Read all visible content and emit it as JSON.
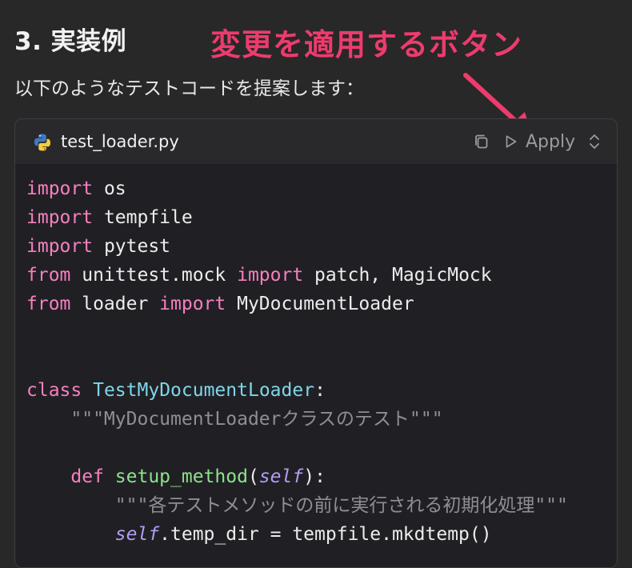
{
  "heading": "3. 実装例",
  "annotation": "変更を適用するボタン",
  "intro": "以下のようなテストコードを提案します：",
  "colors": {
    "annotation": "#ee3b6e",
    "keyword": "#f77fc0",
    "class_name": "#7fd6e9",
    "function_name": "#8fe28a",
    "self": "#b59cf6",
    "docstring": "#8e8e93"
  },
  "code_block": {
    "filename": "test_loader.py",
    "file_icon": "python-icon",
    "copy_icon": "copy-icon",
    "apply_label": "Apply",
    "apply_icon": "play-icon",
    "expand_icon": "chevron-up-down-icon",
    "lines": [
      [
        {
          "t": "import",
          "c": "kw"
        },
        {
          "t": " os",
          "c": "plain"
        }
      ],
      [
        {
          "t": "import",
          "c": "kw"
        },
        {
          "t": " tempfile",
          "c": "plain"
        }
      ],
      [
        {
          "t": "import",
          "c": "kw"
        },
        {
          "t": " pytest",
          "c": "plain"
        }
      ],
      [
        {
          "t": "from",
          "c": "kw"
        },
        {
          "t": " unittest.mock ",
          "c": "plain"
        },
        {
          "t": "import",
          "c": "kw"
        },
        {
          "t": " patch, MagicMock",
          "c": "plain"
        }
      ],
      [
        {
          "t": "from",
          "c": "kw"
        },
        {
          "t": " loader ",
          "c": "plain"
        },
        {
          "t": "import",
          "c": "kw"
        },
        {
          "t": " MyDocumentLoader",
          "c": "plain"
        }
      ],
      [],
      [],
      [
        {
          "t": "class",
          "c": "kw"
        },
        {
          "t": " ",
          "c": "plain"
        },
        {
          "t": "TestMyDocumentLoader",
          "c": "cls"
        },
        {
          "t": ":",
          "c": "plain"
        }
      ],
      [
        {
          "t": "    \"\"\"MyDocumentLoaderクラスのテスト\"\"\"",
          "c": "str"
        }
      ],
      [],
      [
        {
          "t": "    ",
          "c": "plain"
        },
        {
          "t": "def",
          "c": "kw"
        },
        {
          "t": " ",
          "c": "plain"
        },
        {
          "t": "setup_method",
          "c": "fn"
        },
        {
          "t": "(",
          "c": "plain"
        },
        {
          "t": "self",
          "c": "self"
        },
        {
          "t": "):",
          "c": "plain"
        }
      ],
      [
        {
          "t": "        \"\"\"各テストメソッドの前に実行される初期化処理\"\"\"",
          "c": "str"
        }
      ],
      [
        {
          "t": "        ",
          "c": "plain"
        },
        {
          "t": "self",
          "c": "self"
        },
        {
          "t": ".temp_dir = tempfile.mkdtemp()",
          "c": "plain"
        }
      ]
    ]
  }
}
